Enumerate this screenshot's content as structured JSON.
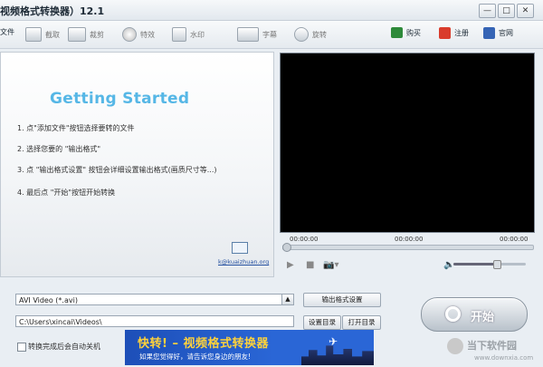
{
  "window": {
    "title": "视频格式转换器）12.1",
    "buttons": {
      "minimize": "—",
      "maximize": "□",
      "close": "✕"
    }
  },
  "toolbar": {
    "items": [
      {
        "label": "文件",
        "icon": "add-file-icon",
        "active": true
      },
      {
        "label": "截取",
        "icon": "film-icon",
        "active": false
      },
      {
        "label": "裁剪",
        "icon": "crop-icon",
        "active": false
      },
      {
        "label": "特效",
        "icon": "effects-icon",
        "active": false
      },
      {
        "label": "水印",
        "icon": "watermark-icon",
        "active": false
      },
      {
        "label": "字幕",
        "icon": "subtitle-icon",
        "active": false
      },
      {
        "label": "旋转",
        "icon": "rotate-icon",
        "active": false
      }
    ],
    "right": [
      {
        "label": "购买",
        "icon": "cart-icon"
      },
      {
        "label": "注册",
        "icon": "register-icon"
      },
      {
        "label": "官网",
        "icon": "home-icon"
      }
    ]
  },
  "guide": {
    "heading": "Getting Started",
    "steps": [
      "1. 点\"添加文件\"按钮选择要转的文件",
      "2. 选择您要的 \"输出格式\"",
      "3. 点 \"输出格式设置\" 按钮会详细设置输出格式(画质尺寸等...)",
      "4. 最后点 \"开始\"按钮开始转换"
    ],
    "email": "k@kuaizhuan.org"
  },
  "player": {
    "time_start": "00:00:00",
    "time_mid": "00:00:00",
    "time_end": "00:00:00",
    "play": "▶",
    "stop": "■",
    "camera": "📷▾",
    "volume": "🔈",
    "volume_level": 0.6
  },
  "output": {
    "format_value": "AVI Video (*.avi)",
    "format_settings_label": "输出格式设置",
    "path_value": "C:\\Users\\xincai\\Videos\\",
    "set_dir_label": "设置目录",
    "open_dir_label": "打开目录",
    "start_label": "开始",
    "shutdown_label": "转换完成后会自动关机"
  },
  "banner": {
    "headline": "快转! – 视频格式转换器",
    "subline": "如果您觉得好，请告诉您身边的朋友!"
  },
  "watermark": {
    "name": "当下软件园",
    "url": "www.downxia.com"
  }
}
